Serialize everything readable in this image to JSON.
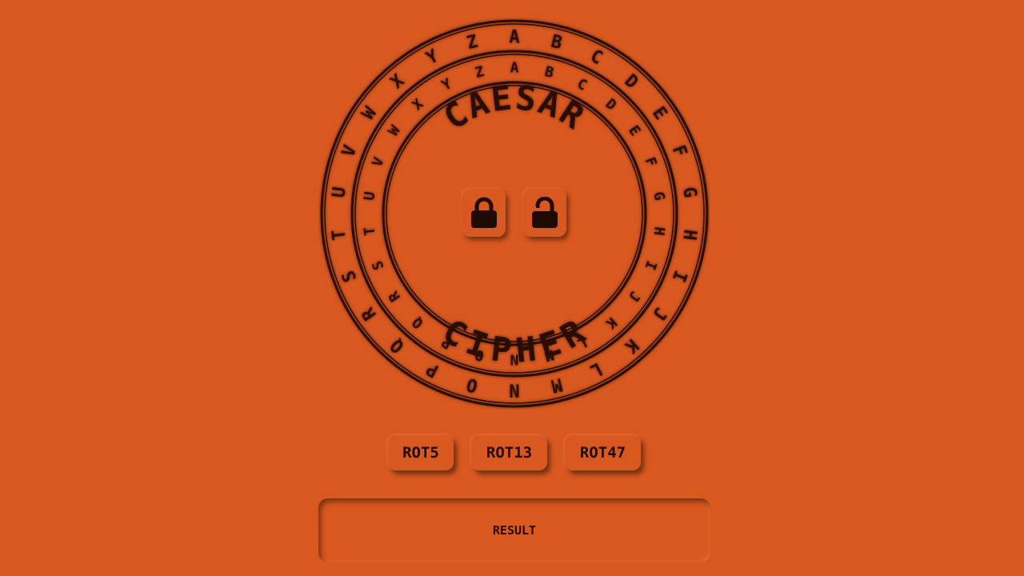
{
  "cipher": {
    "title_top": "CAESAR",
    "title_bottom": "CIPHER",
    "outer_ring": [
      "A",
      "B",
      "C",
      "D",
      "E",
      "F",
      "G",
      "H",
      "I",
      "J",
      "K",
      "L",
      "M",
      "N",
      "O",
      "P",
      "Q",
      "R",
      "S",
      "T",
      "U",
      "V",
      "W",
      "X",
      "Y",
      "Z"
    ],
    "inner_ring": [
      "A",
      "B",
      "C",
      "D",
      "E",
      "F",
      "G",
      "H",
      "I",
      "J",
      "K",
      "L",
      "M",
      "N",
      "O",
      "P",
      "Q",
      "R",
      "S",
      "T",
      "U",
      "V",
      "W",
      "X",
      "Y",
      "Z"
    ]
  },
  "controls": {
    "encrypt_icon": "lock-icon",
    "decrypt_icon": "unlock-icon",
    "rot_buttons": [
      "ROT5",
      "ROT13",
      "ROT47"
    ]
  },
  "result": {
    "label": "RESULT"
  },
  "theme": {
    "background": "#d8581f",
    "ink": "#2a0d02"
  }
}
